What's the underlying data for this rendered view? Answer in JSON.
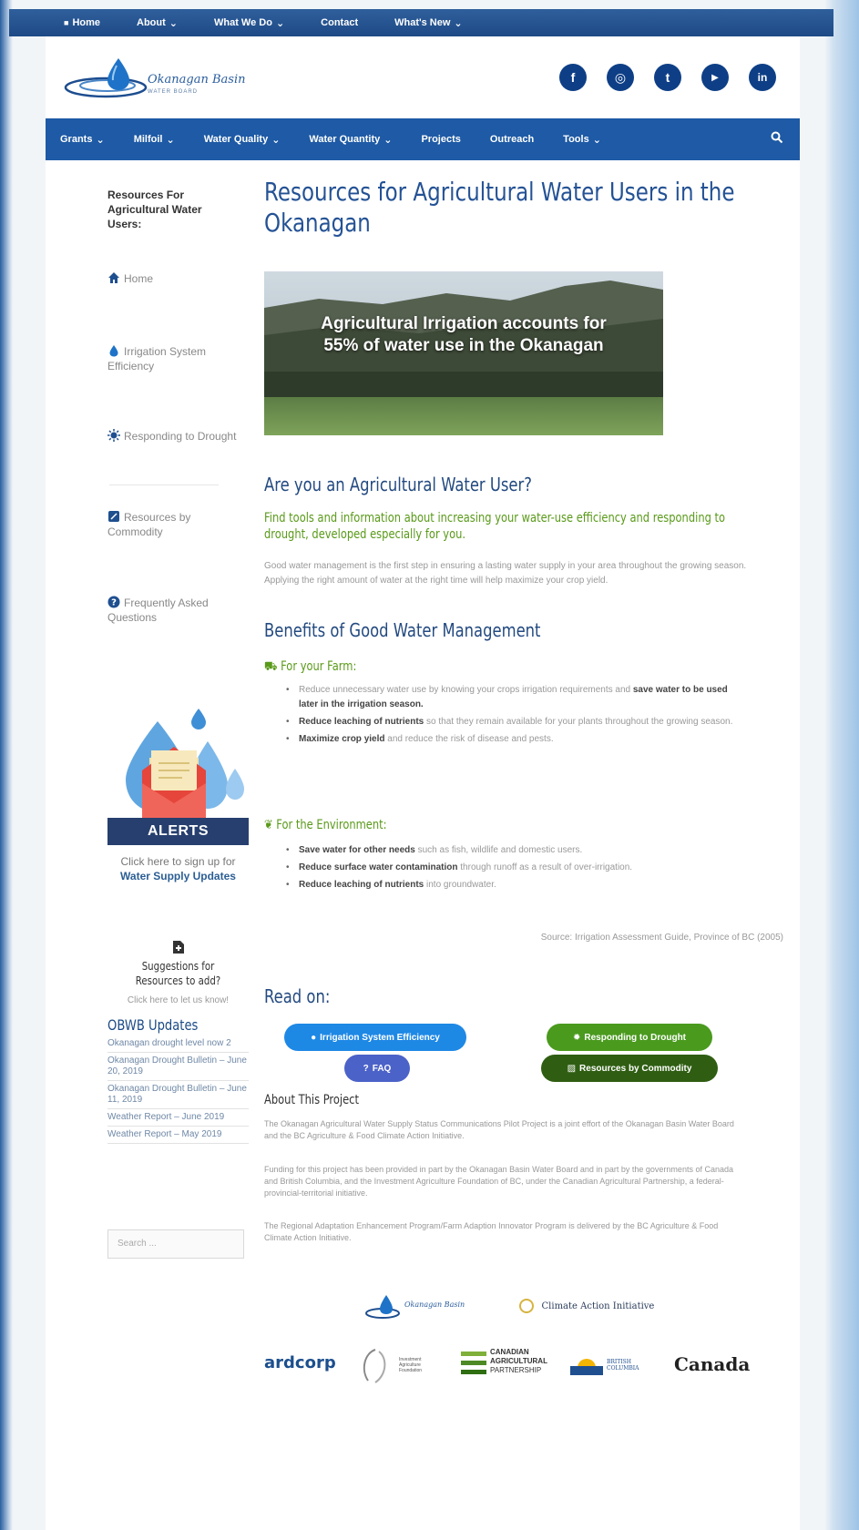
{
  "top_nav": [
    {
      "label": "Home",
      "caret": false,
      "icon": true
    },
    {
      "label": "About",
      "caret": true
    },
    {
      "label": "What We Do",
      "caret": true
    },
    {
      "label": "Contact",
      "caret": false
    },
    {
      "label": "What's New",
      "caret": true
    }
  ],
  "logo": {
    "name": "Okanagan Basin",
    "sub": "WATER BOARD"
  },
  "socials": [
    "f",
    "◎",
    "t",
    "▶",
    "in"
  ],
  "main_nav": [
    {
      "label": "Grants",
      "caret": true
    },
    {
      "label": "Milfoil",
      "caret": true
    },
    {
      "label": "Water Quality",
      "caret": true
    },
    {
      "label": "Water Quantity",
      "caret": true
    },
    {
      "label": "Projects",
      "caret": false
    },
    {
      "label": "Outreach",
      "caret": false
    },
    {
      "label": "Tools",
      "caret": true
    }
  ],
  "sidebar": {
    "title": "Resources For Agricultural Water Users:",
    "items": [
      {
        "icon": "home-icon",
        "label": "Home"
      },
      {
        "icon": "water-drop-icon",
        "label": "Irrigation System Efficiency"
      },
      {
        "icon": "sun-icon",
        "label": "Responding to Drought"
      },
      {
        "icon": "commodity-icon",
        "label": "Resources by Commodity"
      },
      {
        "icon": "question-icon",
        "label": "Frequently Asked Questions"
      }
    ],
    "alerts_label": "ALERTS",
    "signup_text": "Click here to sign up for",
    "signup_link": "Water Supply Updates",
    "suggest_title": "Suggestions for Resources to add?",
    "suggest_link": "Click here to let us know!",
    "updates_title": "OBWB Updates",
    "updates": [
      "Okanagan drought level now 2",
      "Okanagan Drought Bulletin – June 20, 2019",
      "Okanagan Drought Bulletin – June 11, 2019",
      "Weather Report – June 2019",
      "Weather Report – May 2019"
    ],
    "search_placeholder": "Search ..."
  },
  "main": {
    "title": "Resources for Agricultural Water Users in the Okanagan",
    "hero_text": "Agricultural Irrigation accounts for 55% of water use in the Okanagan",
    "h_user": "Are you an Agricultural Water User?",
    "green_sub": "Find tools and information about increasing your water-use efficiency and responding to drought, developed especially for you.",
    "intro": "Good water management is the first step in ensuring a lasting water supply in your area throughout the growing season. Applying the right amount of water at the right time will help maximize your crop yield.",
    "h_benefits": "Benefits of Good Water Management",
    "farm_title": "For your Farm:",
    "farm_bullets": [
      {
        "pre": "Reduce unnecessary water use by knowing your crops irrigation requirements and ",
        "bold": "save water to be used later in the irrigation season.",
        "post": ""
      },
      {
        "pre": "",
        "bold": "Reduce leaching of nutrients",
        "post": " so that they remain available for your plants throughout the growing season."
      },
      {
        "pre": "",
        "bold": "Maximize crop yield",
        "post": " and reduce the risk of disease and pests."
      }
    ],
    "env_title": "For the Environment:",
    "env_bullets": [
      {
        "pre": "",
        "bold": "Save water for other needs",
        "post": " such as fish, wildlife and domestic users."
      },
      {
        "pre": "",
        "bold": "Reduce surface water contamination",
        "post": " through runoff as a result of over-irrigation."
      },
      {
        "pre": "",
        "bold": "Reduce leaching of nutrients",
        "post": " into groundwater."
      }
    ],
    "source": "Source: Irrigation Assessment Guide, Province of BC (2005)",
    "read_on": "Read on:",
    "buttons": {
      "irrigation": "Irrigation System Efficiency",
      "drought": "Responding to Drought",
      "faq": "FAQ",
      "commodity": "Resources by Commodity"
    },
    "about_title": "About This Project",
    "about_p1": "The Okanagan Agricultural Water Supply Status Communications Pilot Project is a joint effort of the Okanagan Basin Water Board and the BC Agriculture & Food Climate Action Initiative.",
    "about_p2": "Funding for this project has been provided in part by the Okanagan Basin Water Board and in part by the governments of Canada and British Columbia, and the Investment Agriculture Foundation of BC, under the Canadian Agricultural Partnership, a federal-provincial-territorial initiative.",
    "about_p3": "The Regional Adaptation Enhancement Program/Farm Adaption Innovator Program is delivered by the BC Agriculture & Food Climate Action Initiative."
  },
  "sponsors": {
    "obwb": "Okanagan Basin",
    "climate": "Climate Action Initiative",
    "ardcorp": "ardcorp",
    "iaf": "Investment Agriculture Foundation",
    "cap": [
      "CANADIAN",
      "AGRICULTURAL",
      "PARTNERSHIP"
    ],
    "bc": [
      "BRITISH",
      "COLUMBIA"
    ],
    "canada": "Canada"
  },
  "colors": {
    "top_bar": "#1e4a86",
    "main_nav": "#1e5aa5",
    "title_blue": "#245295",
    "green": "#5a9a1a",
    "btn_blue": "#1e88e5",
    "btn_green": "#4a9a1e",
    "btn_darkgreen": "#2f5e12",
    "btn_purple": "#4b62c8"
  }
}
